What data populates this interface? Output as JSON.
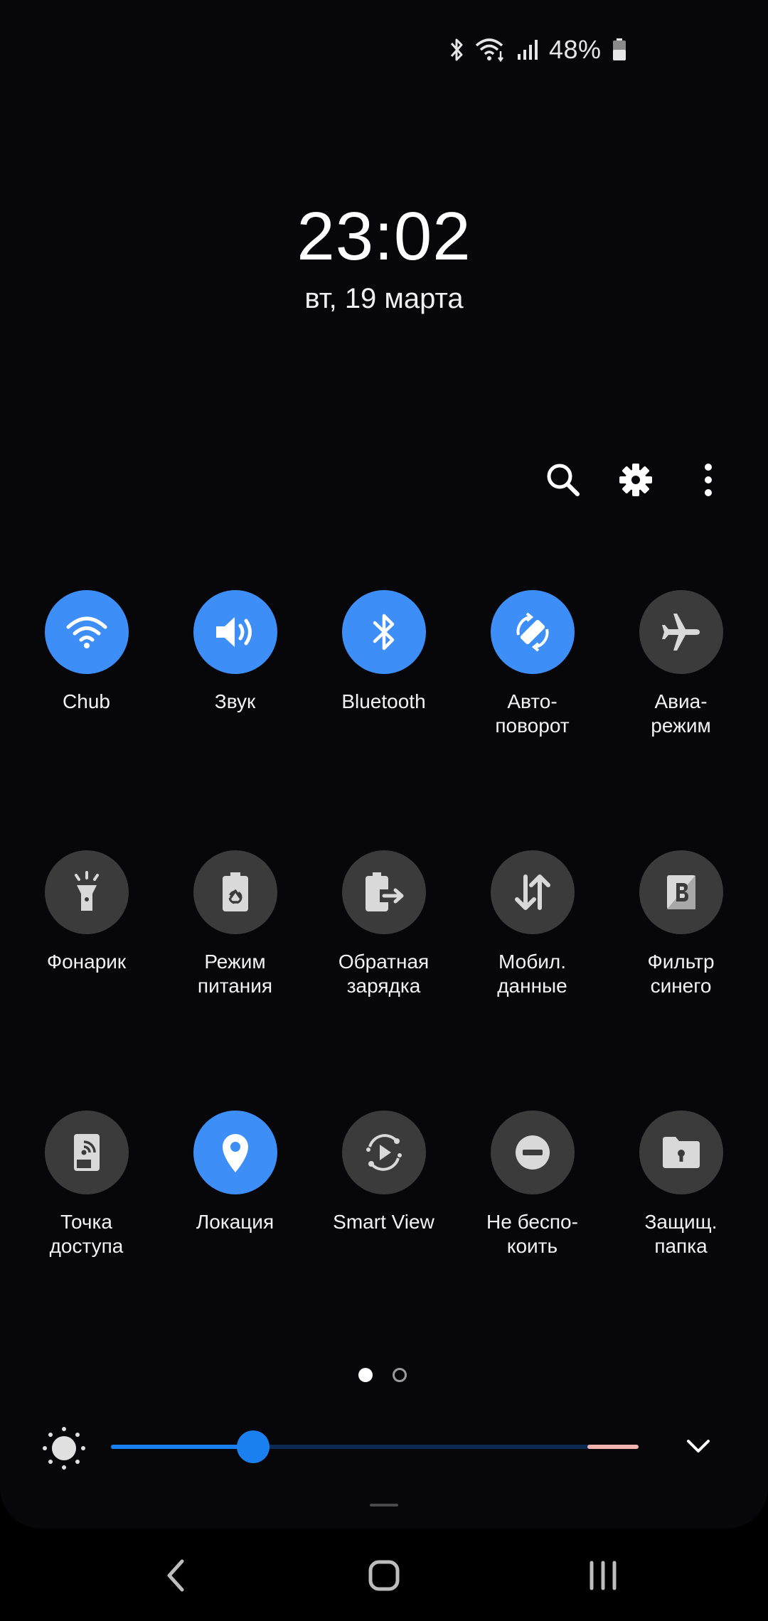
{
  "status_bar": {
    "battery_text": "48%",
    "icons": [
      "bluetooth-icon",
      "wifi-icon",
      "signal-icon",
      "battery-icon"
    ]
  },
  "clock": {
    "time": "23:02",
    "date": "вт, 19 марта"
  },
  "top_actions": [
    "search-icon",
    "settings-gear-icon",
    "more-vertical-icon"
  ],
  "tiles": [
    {
      "label": "Chub",
      "icon": "wifi-icon",
      "active": true
    },
    {
      "label": "Звук",
      "icon": "volume-icon",
      "active": true
    },
    {
      "label": "Bluetooth",
      "icon": "bluetooth-icon",
      "active": true
    },
    {
      "label": "Авто-\nповорот",
      "icon": "auto-rotate-icon",
      "active": true
    },
    {
      "label": "Авиа-\nрежим",
      "icon": "airplane-icon",
      "active": false
    },
    {
      "label": "Фонарик",
      "icon": "flashlight-icon",
      "active": false
    },
    {
      "label": "Режим\nпитания",
      "icon": "power-mode-icon",
      "active": false
    },
    {
      "label": "Обратная\nзарядка",
      "icon": "reverse-charging-icon",
      "active": false
    },
    {
      "label": "Мобил.\nданные",
      "icon": "mobile-data-icon",
      "active": false
    },
    {
      "label": "Фильтр\nсинего",
      "icon": "blue-light-filter-icon",
      "active": false
    },
    {
      "label": "Точка\nдоступа",
      "icon": "hotspot-icon",
      "active": false
    },
    {
      "label": "Локация",
      "icon": "location-icon",
      "active": true
    },
    {
      "label": "Smart View",
      "icon": "smart-view-icon",
      "active": false
    },
    {
      "label": "Не беспо-\nкоить",
      "icon": "do-not-disturb-icon",
      "active": false
    },
    {
      "label": "Защищ.\nпапка",
      "icon": "secure-folder-icon",
      "active": false
    }
  ],
  "pagination": {
    "current": 1,
    "total": 2
  },
  "brightness": {
    "level_percent": 27
  },
  "colors": {
    "active": "#3e8ef7",
    "inactive": "#3b3b3c",
    "slider": "#1a80f0"
  }
}
